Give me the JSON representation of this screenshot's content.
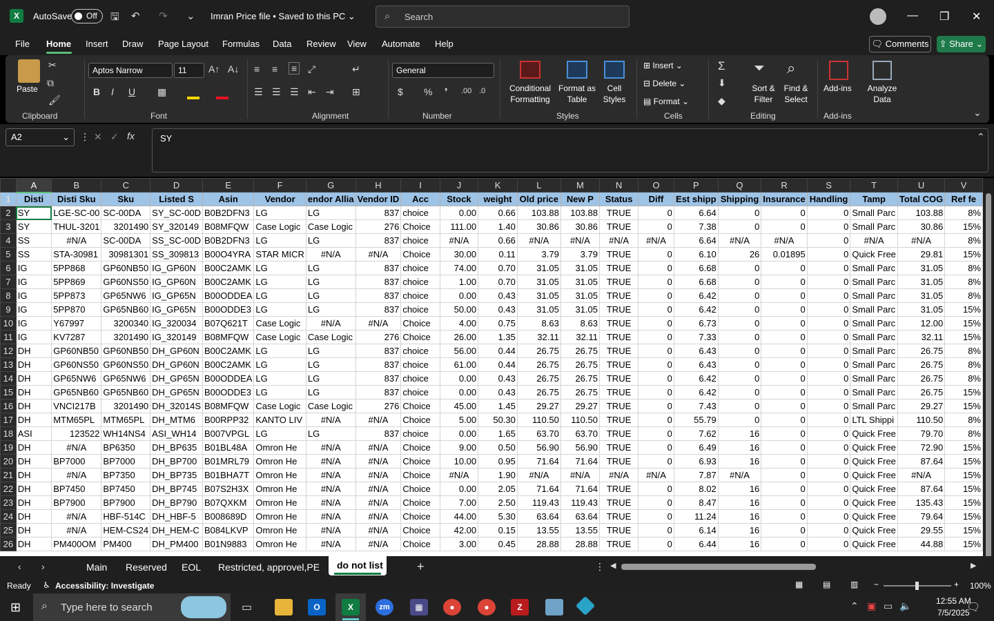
{
  "titlebar": {
    "app_logo": "X",
    "autosave_label": "AutoSave",
    "autosave_state": "Off",
    "doc_title": "Imran Price file • Saved to this PC",
    "search_placeholder": "Search"
  },
  "menu": {
    "items": [
      "File",
      "Home",
      "Insert",
      "Draw",
      "Page Layout",
      "Formulas",
      "Data",
      "Review",
      "View",
      "Automate",
      "Help"
    ],
    "active": "Home",
    "comments_label": "Comments",
    "share_label": "Share"
  },
  "ribbon": {
    "clipboard": {
      "label": "Clipboard",
      "paste": "Paste"
    },
    "font": {
      "label": "Font",
      "name": "Aptos Narrow",
      "size": "11"
    },
    "alignment": {
      "label": "Alignment"
    },
    "number": {
      "label": "Number",
      "format": "General"
    },
    "styles": {
      "label": "Styles",
      "conditional": "Conditional\nFormatting",
      "format_table": "Format as\nTable",
      "cell_styles": "Cell\nStyles"
    },
    "cells": {
      "label": "Cells",
      "insert": "Insert",
      "delete": "Delete",
      "format": "Format"
    },
    "editing": {
      "label": "Editing",
      "sort": "Sort &\nFilter",
      "find": "Find &\nSelect"
    },
    "addins": {
      "label": "Add-ins",
      "addins": "Add-ins",
      "analyze": "Analyze\nData"
    }
  },
  "formula_bar": {
    "name_box": "A2",
    "content": "SY"
  },
  "columns": [
    "A",
    "B",
    "C",
    "D",
    "E",
    "F",
    "G",
    "H",
    "I",
    "J",
    "K",
    "L",
    "M",
    "N",
    "O",
    "P",
    "Q",
    "R",
    "S",
    "T",
    "U",
    "V"
  ],
  "header_row": [
    "Disti",
    "Disti Sku",
    "Sku",
    "Listed S",
    "Asin",
    "Vendor",
    "endor Allia",
    "Vendor ID",
    "Acc",
    "Stock",
    "weight",
    "Old price",
    "New P",
    "Status",
    "Diff",
    "Est shipp",
    "Shipping",
    "Insurance",
    "Handling",
    "Tamp",
    "Total COG",
    "Ref fe"
  ],
  "rows": [
    [
      "SY",
      "LGE-SC-00",
      "SC-00DA",
      "SY_SC-00D",
      "B0B2DFN3",
      "LG",
      "LG",
      "837",
      "choice",
      "0.00",
      "0.66",
      "103.88",
      "103.88",
      "TRUE",
      "0",
      "6.64",
      "0",
      "0",
      "0",
      "Small Parc",
      "103.88",
      "8%"
    ],
    [
      "SY",
      "THUL-3201",
      "3201490",
      "SY_320149",
      "B08MFQW",
      "Case Logic",
      "Case Logic",
      "276",
      "Choice",
      "111.00",
      "1.40",
      "30.86",
      "30.86",
      "TRUE",
      "0",
      "7.38",
      "0",
      "0",
      "0",
      "Small Parc",
      "30.86",
      "15%"
    ],
    [
      "SS",
      "#N/A",
      "SC-00DA",
      "SS_SC-00D",
      "B0B2DFN3",
      "LG",
      "LG",
      "837",
      "choice",
      "#N/A",
      "0.66",
      "#N/A",
      "#N/A",
      "#N/A",
      "#N/A",
      "6.64",
      "#N/A",
      "#N/A",
      "0",
      "#N/A",
      "#N/A",
      "8%"
    ],
    [
      "SS",
      "STA-30981",
      "30981301",
      "SS_309813",
      "B00O4YRA",
      "STAR MICR",
      "#N/A",
      "#N/A",
      "Choice",
      "30.00",
      "0.11",
      "3.79",
      "3.79",
      "TRUE",
      "0",
      "6.10",
      "26",
      "0.01895",
      "0",
      "Quick Free",
      "29.81",
      "15%"
    ],
    [
      "IG",
      "5PP868",
      "GP60NB50",
      "IG_GP60N",
      "B00C2AMK",
      "LG",
      "LG",
      "837",
      "choice",
      "74.00",
      "0.70",
      "31.05",
      "31.05",
      "TRUE",
      "0",
      "6.68",
      "0",
      "0",
      "0",
      "Small Parc",
      "31.05",
      "8%"
    ],
    [
      "IG",
      "5PP869",
      "GP60NS50",
      "IG_GP60N",
      "B00C2AMK",
      "LG",
      "LG",
      "837",
      "choice",
      "1.00",
      "0.70",
      "31.05",
      "31.05",
      "TRUE",
      "0",
      "6.68",
      "0",
      "0",
      "0",
      "Small Parc",
      "31.05",
      "8%"
    ],
    [
      "IG",
      "5PP873",
      "GP65NW6",
      "IG_GP65N",
      "B00ODDEA",
      "LG",
      "LG",
      "837",
      "choice",
      "0.00",
      "0.43",
      "31.05",
      "31.05",
      "TRUE",
      "0",
      "6.42",
      "0",
      "0",
      "0",
      "Small Parc",
      "31.05",
      "8%"
    ],
    [
      "IG",
      "5PP870",
      "GP65NB60",
      "IG_GP65N",
      "B00ODDE3",
      "LG",
      "LG",
      "837",
      "choice",
      "50.00",
      "0.43",
      "31.05",
      "31.05",
      "TRUE",
      "0",
      "6.42",
      "0",
      "0",
      "0",
      "Small Parc",
      "31.05",
      "15%"
    ],
    [
      "IG",
      "Y67997",
      "3200340",
      "IG_320034",
      "B07Q621T",
      "Case Logic",
      "#N/A",
      "#N/A",
      "Choice",
      "4.00",
      "0.75",
      "8.63",
      "8.63",
      "TRUE",
      "0",
      "6.73",
      "0",
      "0",
      "0",
      "Small Parc",
      "12.00",
      "15%"
    ],
    [
      "IG",
      "KV7287",
      "3201490",
      "IG_320149",
      "B08MFQW",
      "Case Logic",
      "Case Logic",
      "276",
      "Choice",
      "26.00",
      "1.35",
      "32.11",
      "32.11",
      "TRUE",
      "0",
      "7.33",
      "0",
      "0",
      "0",
      "Small Parc",
      "32.11",
      "15%"
    ],
    [
      "DH",
      "GP60NB50",
      "GP60NB50",
      "DH_GP60N",
      "B00C2AMK",
      "LG",
      "LG",
      "837",
      "choice",
      "56.00",
      "0.44",
      "26.75",
      "26.75",
      "TRUE",
      "0",
      "6.43",
      "0",
      "0",
      "0",
      "Small Parc",
      "26.75",
      "8%"
    ],
    [
      "DH",
      "GP60NS50",
      "GP60NS50",
      "DH_GP60N",
      "B00C2AMK",
      "LG",
      "LG",
      "837",
      "choice",
      "61.00",
      "0.44",
      "26.75",
      "26.75",
      "TRUE",
      "0",
      "6.43",
      "0",
      "0",
      "0",
      "Small Parc",
      "26.75",
      "8%"
    ],
    [
      "DH",
      "GP65NW6",
      "GP65NW6",
      "DH_GP65N",
      "B00ODDEA",
      "LG",
      "LG",
      "837",
      "choice",
      "0.00",
      "0.43",
      "26.75",
      "26.75",
      "TRUE",
      "0",
      "6.42",
      "0",
      "0",
      "0",
      "Small Parc",
      "26.75",
      "8%"
    ],
    [
      "DH",
      "GP65NB60",
      "GP65NB60",
      "DH_GP65N",
      "B00ODDE3",
      "LG",
      "LG",
      "837",
      "choice",
      "0.00",
      "0.43",
      "26.75",
      "26.75",
      "TRUE",
      "0",
      "6.42",
      "0",
      "0",
      "0",
      "Small Parc",
      "26.75",
      "15%"
    ],
    [
      "DH",
      "VNCI217B",
      "3201490",
      "DH_32014S",
      "B08MFQW",
      "Case Logic",
      "Case Logic",
      "276",
      "Choice",
      "45.00",
      "1.45",
      "29.27",
      "29.27",
      "TRUE",
      "0",
      "7.43",
      "0",
      "0",
      "0",
      "Small Parc",
      "29.27",
      "15%"
    ],
    [
      "DH",
      "MTM65PL",
      "MTM65PL",
      "DH_MTM6",
      "B00RPP32",
      "KANTO LIV",
      "#N/A",
      "#N/A",
      "Choice",
      "5.00",
      "50.30",
      "110.50",
      "110.50",
      "TRUE",
      "0",
      "55.79",
      "0",
      "0",
      "0",
      "LTL Shippi",
      "110.50",
      "8%"
    ],
    [
      "ASI",
      "123522",
      "WH14NS4",
      "ASI_WH14",
      "B007VPGL",
      "LG",
      "LG",
      "837",
      "choice",
      "0.00",
      "1.65",
      "63.70",
      "63.70",
      "TRUE",
      "0",
      "7.62",
      "16",
      "0",
      "0",
      "Quick Free",
      "79.70",
      "8%"
    ],
    [
      "DH",
      "#N/A",
      "BP6350",
      "DH_BP635",
      "B01BL48A",
      "Omron He",
      "#N/A",
      "#N/A",
      "Choice",
      "9.00",
      "0.50",
      "56.90",
      "56.90",
      "TRUE",
      "0",
      "6.49",
      "16",
      "0",
      "0",
      "Quick Free",
      "72.90",
      "15%"
    ],
    [
      "DH",
      "BP7000",
      "BP7000",
      "DH_BP700",
      "B01MRL79",
      "Omron He",
      "#N/A",
      "#N/A",
      "Choice",
      "10.00",
      "0.95",
      "71.64",
      "71.64",
      "TRUE",
      "0",
      "6.93",
      "16",
      "0",
      "0",
      "Quick Free",
      "87.64",
      "15%"
    ],
    [
      "DH",
      "#N/A",
      "BP7350",
      "DH_BP735",
      "B01BHA7T",
      "Omron He",
      "#N/A",
      "#N/A",
      "Choice",
      "#N/A",
      "1.90",
      "#N/A",
      "#N/A",
      "#N/A",
      "#N/A",
      "7.87",
      "#N/A",
      "0",
      "0",
      "Quick Free",
      "#N/A",
      "15%"
    ],
    [
      "DH",
      "BP7450",
      "BP7450",
      "DH_BP745",
      "B07S2H3X",
      "Omron He",
      "#N/A",
      "#N/A",
      "Choice",
      "0.00",
      "2.05",
      "71.64",
      "71.64",
      "TRUE",
      "0",
      "8.02",
      "16",
      "0",
      "0",
      "Quick Free",
      "87.64",
      "15%"
    ],
    [
      "DH",
      "BP7900",
      "BP7900",
      "DH_BP790",
      "B07QXKM",
      "Omron He",
      "#N/A",
      "#N/A",
      "Choice",
      "7.00",
      "2.50",
      "119.43",
      "119.43",
      "TRUE",
      "0",
      "8.47",
      "16",
      "0",
      "0",
      "Quick Free",
      "135.43",
      "15%"
    ],
    [
      "DH",
      "#N/A",
      "HBF-514C",
      "DH_HBF-5",
      "B008689D",
      "Omron He",
      "#N/A",
      "#N/A",
      "Choice",
      "44.00",
      "5.30",
      "63.64",
      "63.64",
      "TRUE",
      "0",
      "11.24",
      "16",
      "0",
      "0",
      "Quick Free",
      "79.64",
      "15%"
    ],
    [
      "DH",
      "#N/A",
      "HEM-CS24",
      "DH_HEM-C",
      "B084LKVP",
      "Omron He",
      "#N/A",
      "#N/A",
      "Choice",
      "42.00",
      "0.15",
      "13.55",
      "13.55",
      "TRUE",
      "0",
      "6.14",
      "16",
      "0",
      "0",
      "Quick Free",
      "29.55",
      "15%"
    ],
    [
      "DH",
      "PM400OM",
      "PM400",
      "DH_PM400",
      "B01N9883",
      "Omron He",
      "#N/A",
      "#N/A",
      "Choice",
      "3.00",
      "0.45",
      "28.88",
      "28.88",
      "TRUE",
      "0",
      "6.44",
      "16",
      "0",
      "0",
      "Quick Free",
      "44.88",
      "15%"
    ]
  ],
  "sheet_tabs": [
    "Main",
    "Reserved",
    "EOL",
    "Restricted, approvel,PE",
    "do not list"
  ],
  "active_sheet": "do not list",
  "status": {
    "ready": "Ready",
    "accessibility": "Accessibility: Investigate",
    "zoom": "100%"
  },
  "taskbar": {
    "search_placeholder": "Type here to search",
    "time": "12:55 AM",
    "date": "7/5/2025"
  }
}
